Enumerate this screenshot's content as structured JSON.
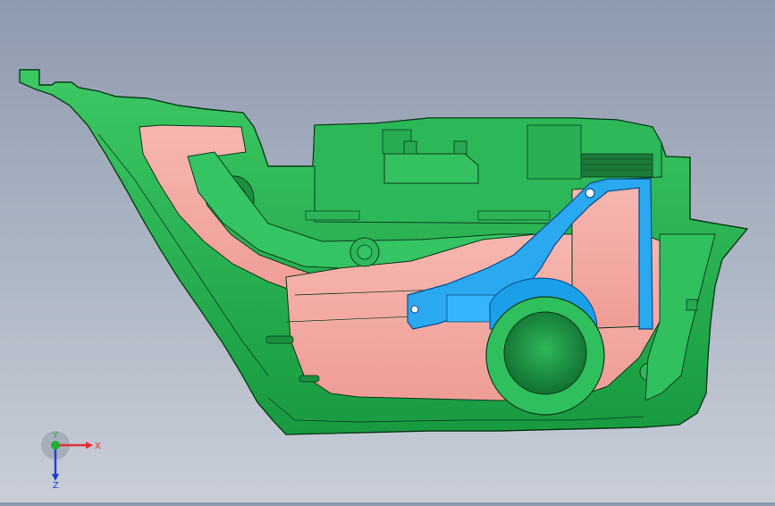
{
  "model": {
    "body_color": "#1ea84a",
    "body_light": "#4fd07a",
    "edge_color": "#0b3b1a",
    "pink_color": "#f2a6a0",
    "blue_color": "#2aa9f0",
    "blue_dark": "#0b4a8a"
  },
  "triad": {
    "x_label": "X",
    "y_label": "Y",
    "z_label": "Z",
    "x_color": "#e03030",
    "y_color": "#22b030",
    "z_color": "#2040d0"
  }
}
